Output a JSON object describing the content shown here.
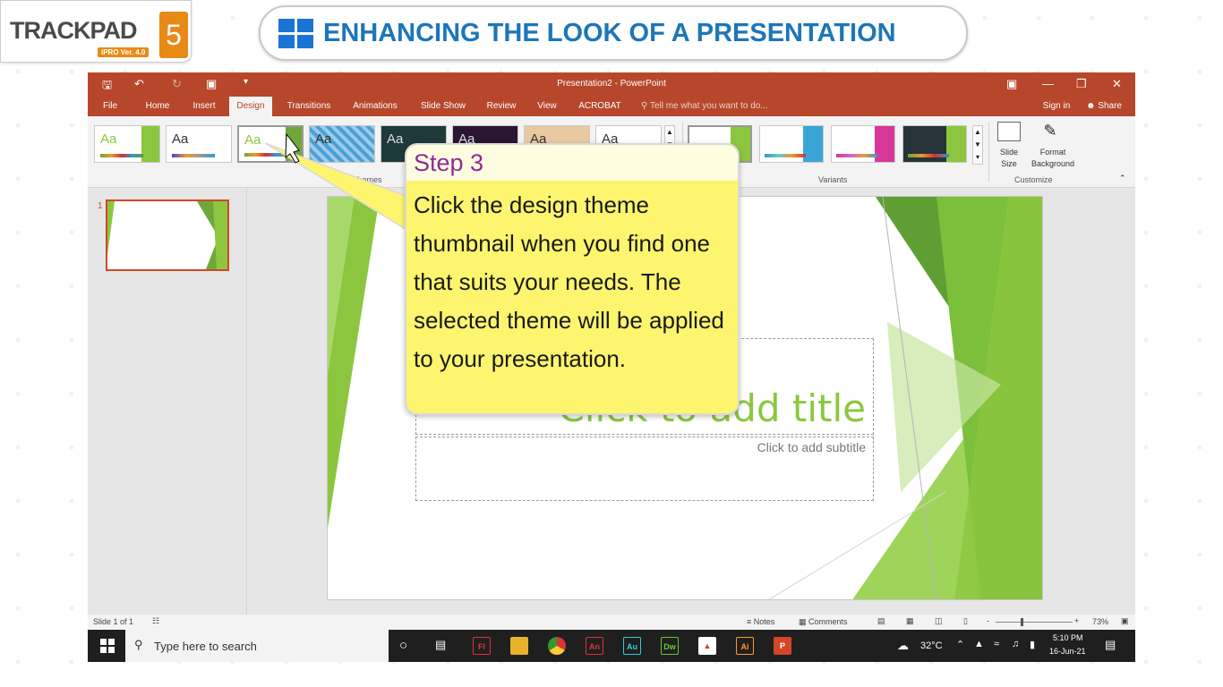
{
  "header": {
    "logo_text": "TRACKPAD",
    "logo_version": "iPRO Ver. 4.0",
    "logo_number": "5",
    "banner_title": "ENHANCING THE LOOK OF A PRESENTATION"
  },
  "window": {
    "title": "Presentation2 - PowerPoint",
    "sign_in": "Sign in",
    "share": "Share",
    "tell_me": "Tell me what you want to do...",
    "tabs": [
      "File",
      "Home",
      "Insert",
      "Design",
      "Transitions",
      "Animations",
      "Slide Show",
      "Review",
      "View",
      "ACROBAT"
    ]
  },
  "ribbon": {
    "themes_label": "Themes",
    "variants_label": "Variants",
    "customize_label": "Customize",
    "theme_aa": "Aa",
    "slide_size": "Slide Size",
    "format_background": "Format Background"
  },
  "slide": {
    "thumb_number": "1",
    "title_placeholder": "Click to add title",
    "subtitle_placeholder": "Click to add subtitle"
  },
  "status": {
    "slide_count": "Slide 1 of 1",
    "notes": "Notes",
    "comments": "Comments",
    "zoom": "73%"
  },
  "taskbar": {
    "search_placeholder": "Type here to search",
    "temperature": "32°C",
    "time": "5:10 PM",
    "date": "16-Jun-21",
    "apps": [
      "Fl",
      "An",
      "Au",
      "Dw",
      "Ai",
      "P"
    ]
  },
  "callout": {
    "step": "Step 3",
    "text": "Click the design theme thumbnail when you find one that suits your needs. The selected theme will be applied to your presentation."
  }
}
